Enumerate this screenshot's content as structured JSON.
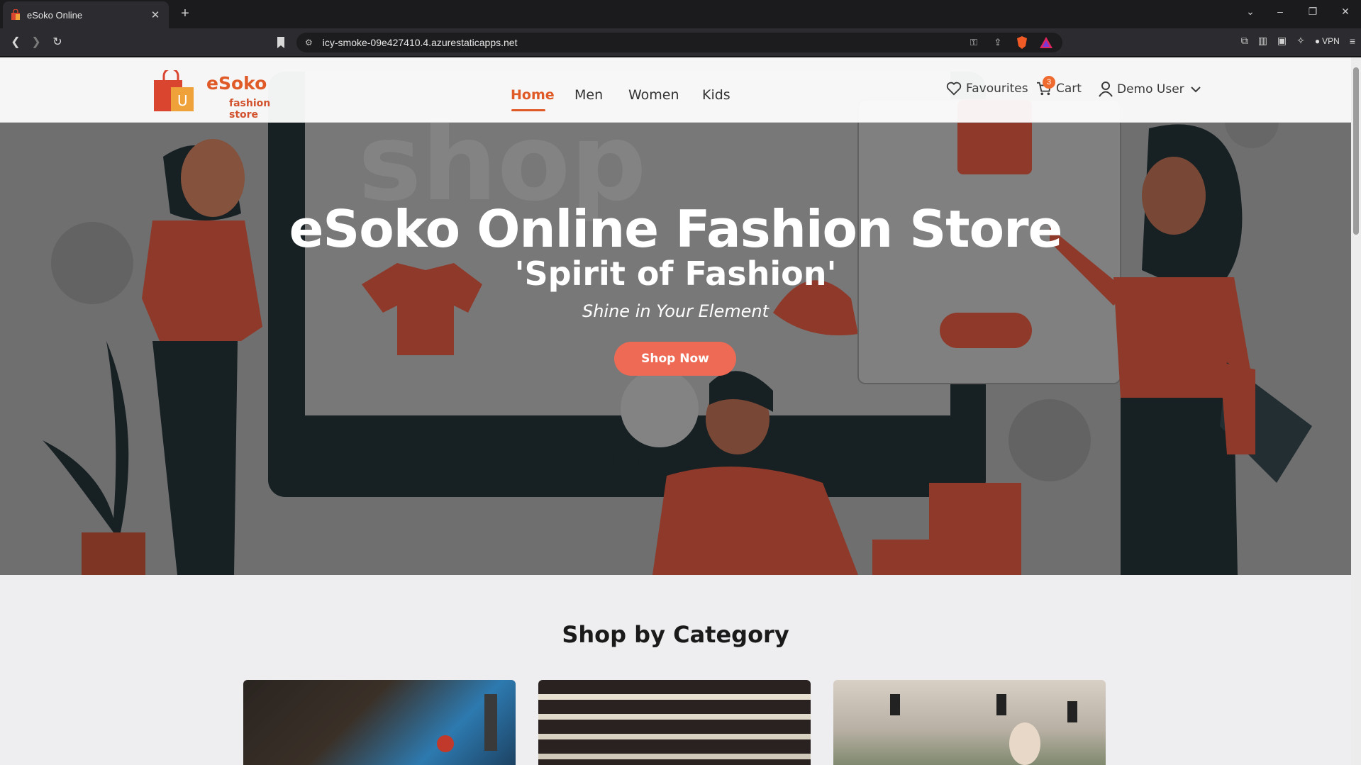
{
  "browser": {
    "tab_title": "eSoko Online",
    "url": "icy-smoke-09e427410.4.azurestaticapps.net",
    "vpn_label": "VPN"
  },
  "header": {
    "brand": "eSoko",
    "brand_tagline": "fashion store",
    "nav": [
      "Home",
      "Men",
      "Women",
      "Kids"
    ],
    "active_nav": "Home",
    "favourites_label": "Favourites",
    "cart_label": "Cart",
    "cart_count": "3",
    "user_label": "Demo User"
  },
  "hero": {
    "title": "eSoko Online Fashion Store",
    "subtitle": "'Spirit of Fashion'",
    "tagline": "Shine in Your Element",
    "cta_label": "Shop Now",
    "illustration_text": "shop"
  },
  "category_section": {
    "heading": "Shop by Category"
  },
  "colors": {
    "accent": "#e05a28",
    "cta": "#ef6a55",
    "illustration_red": "#c04a36",
    "illustration_dark": "#1e2a2e"
  }
}
